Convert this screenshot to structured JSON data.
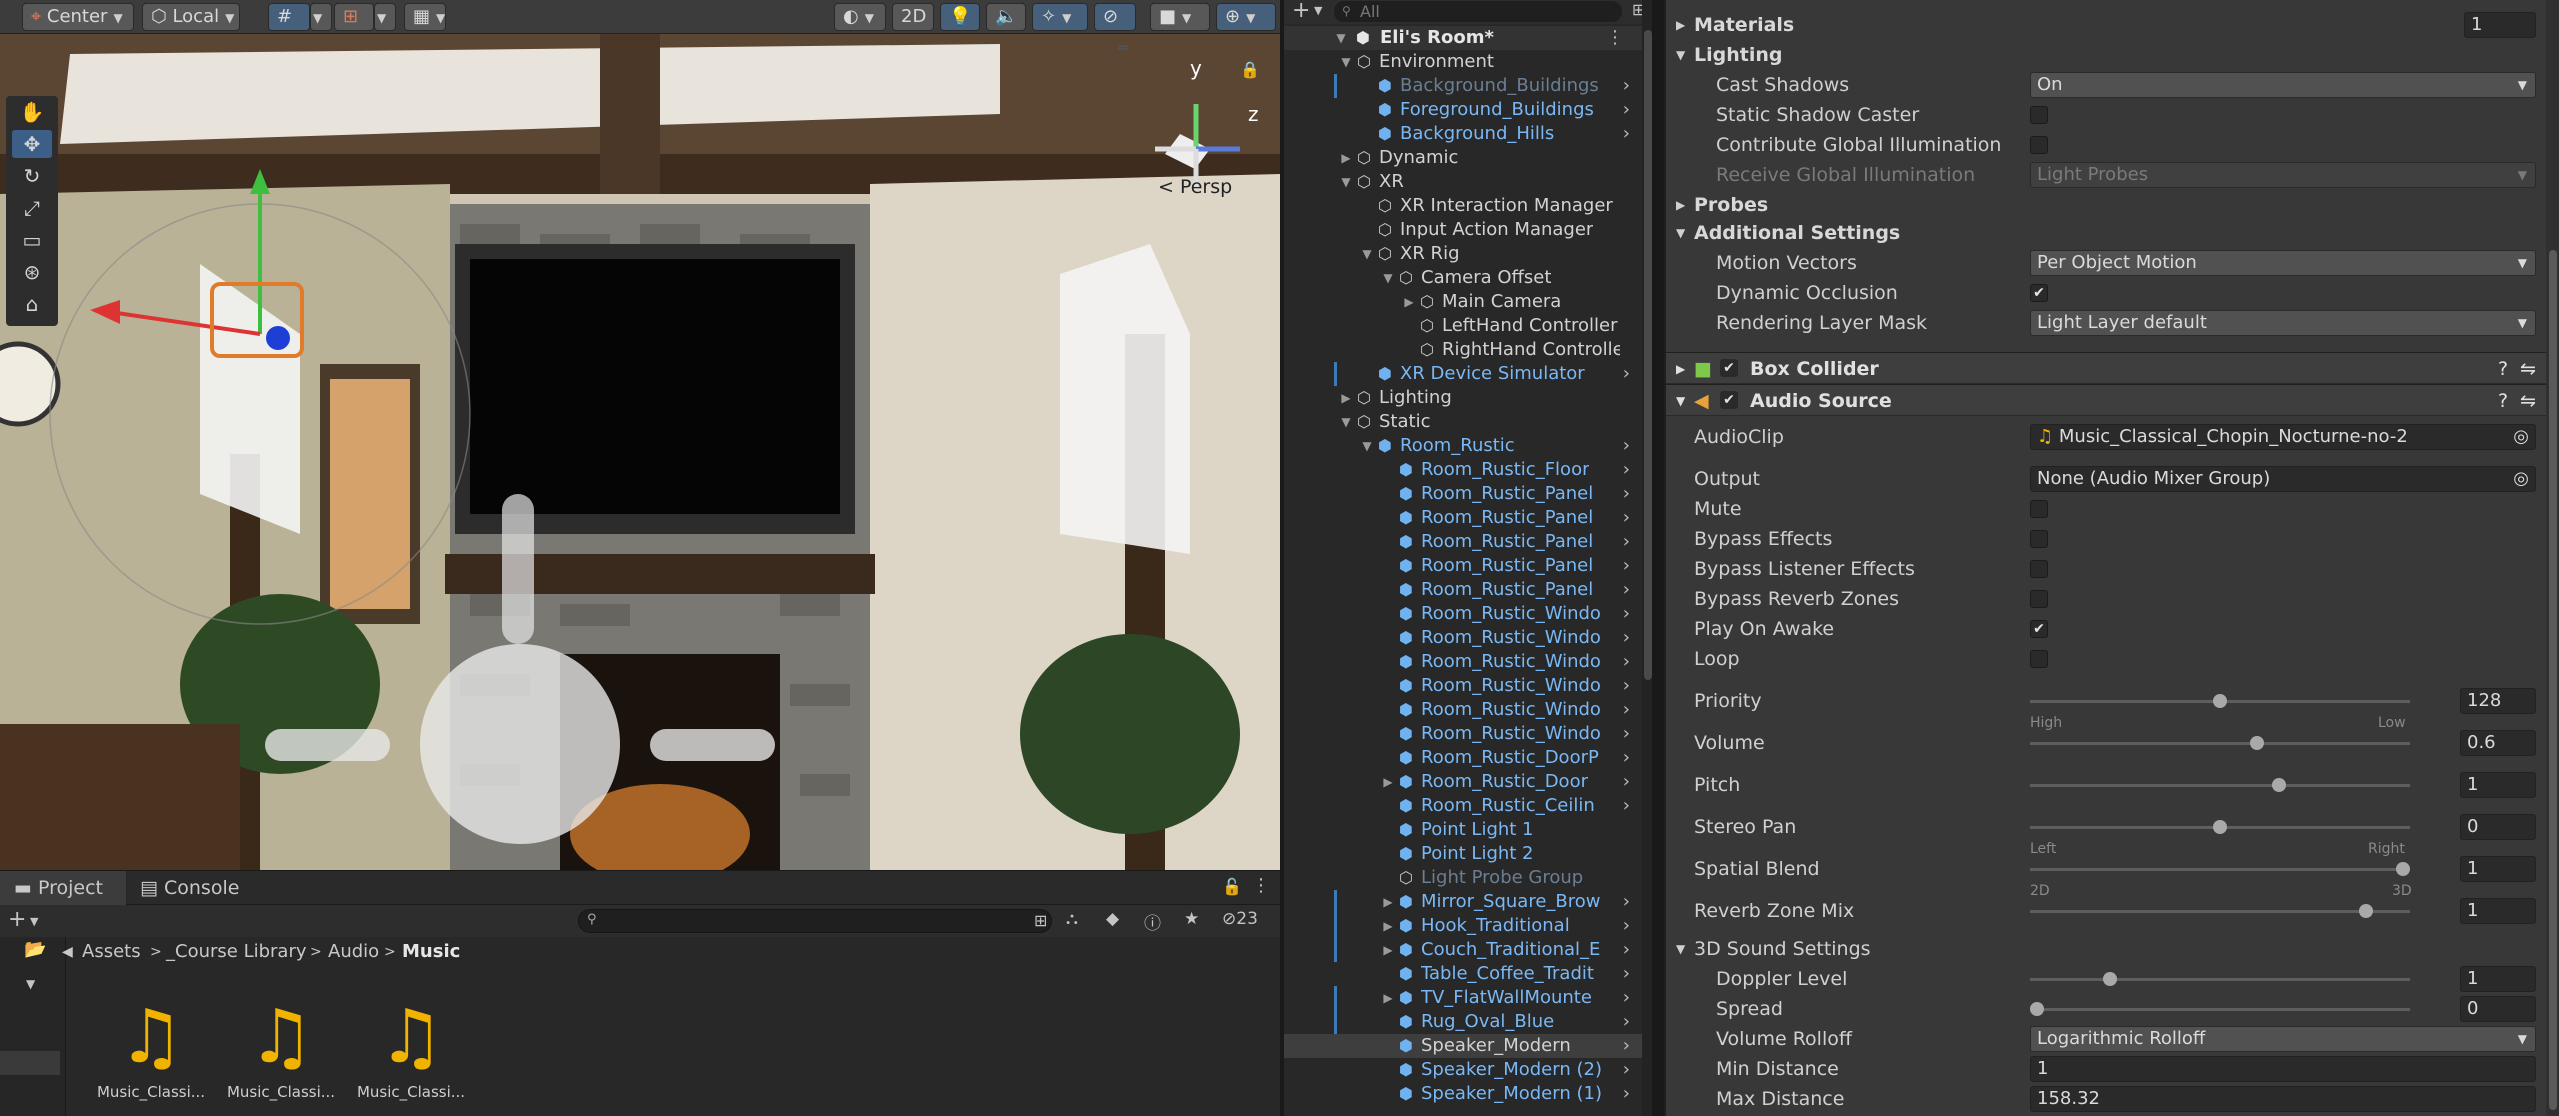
{
  "toolbar": {
    "pivot": "Center",
    "space": "Local",
    "mode_2d": "2D",
    "search_placeholder": "All"
  },
  "scene": {
    "persp_label": "< Persp",
    "gizmo_y": "y",
    "gizmo_z": "z"
  },
  "project": {
    "tab_project": "Project",
    "tab_console": "Console",
    "breadcrumb": [
      "Assets",
      "_Course Library",
      "Audio",
      "Music"
    ],
    "hidden_count": "23",
    "assets": [
      "Music_Classi...",
      "Music_Classi...",
      "Music_Classi..."
    ]
  },
  "hierarchy": {
    "scene_name": "Eli's Room*",
    "items": [
      {
        "label": "Environment",
        "depth": 1,
        "expanded": true,
        "style": "plain",
        "kind": "object"
      },
      {
        "label": "Background_Buildings",
        "depth": 2,
        "style": "dim",
        "kind": "prefab",
        "more": true,
        "bar": true
      },
      {
        "label": "Foreground_Buildings",
        "depth": 2,
        "style": "blue",
        "kind": "prefab",
        "more": true
      },
      {
        "label": "Background_Hills",
        "depth": 2,
        "style": "blue",
        "kind": "prefab",
        "more": true
      },
      {
        "label": "Dynamic",
        "depth": 1,
        "expanded": false,
        "style": "plain",
        "kind": "object"
      },
      {
        "label": "XR",
        "depth": 1,
        "expanded": true,
        "style": "plain",
        "kind": "object"
      },
      {
        "label": "XR Interaction Manager",
        "depth": 2,
        "style": "plain",
        "kind": "object"
      },
      {
        "label": "Input Action Manager",
        "depth": 2,
        "style": "plain",
        "kind": "object"
      },
      {
        "label": "XR Rig",
        "depth": 2,
        "expanded": true,
        "style": "plain",
        "kind": "object"
      },
      {
        "label": "Camera Offset",
        "depth": 3,
        "expanded": true,
        "style": "plain",
        "kind": "object"
      },
      {
        "label": "Main Camera",
        "depth": 4,
        "expanded": false,
        "style": "plain",
        "kind": "object"
      },
      {
        "label": "LeftHand Controller",
        "depth": 4,
        "style": "plain",
        "kind": "object"
      },
      {
        "label": "RightHand Controlle",
        "depth": 4,
        "style": "plain",
        "kind": "object"
      },
      {
        "label": "XR Device Simulator",
        "depth": 2,
        "style": "blue",
        "kind": "prefab",
        "more": true,
        "bar": true
      },
      {
        "label": "Lighting",
        "depth": 1,
        "expanded": false,
        "style": "plain",
        "kind": "object"
      },
      {
        "label": "Static",
        "depth": 1,
        "expanded": true,
        "style": "plain",
        "kind": "object"
      },
      {
        "label": "Room_Rustic",
        "depth": 2,
        "expanded": true,
        "style": "blue",
        "kind": "prefab",
        "more": true
      },
      {
        "label": "Room_Rustic_Floor",
        "depth": 3,
        "style": "blue",
        "kind": "prefab",
        "more": true
      },
      {
        "label": "Room_Rustic_Panel",
        "depth": 3,
        "style": "blue",
        "kind": "prefab",
        "more": true
      },
      {
        "label": "Room_Rustic_Panel",
        "depth": 3,
        "style": "blue",
        "kind": "prefab",
        "more": true
      },
      {
        "label": "Room_Rustic_Panel",
        "depth": 3,
        "style": "blue",
        "kind": "prefab",
        "more": true
      },
      {
        "label": "Room_Rustic_Panel",
        "depth": 3,
        "style": "blue",
        "kind": "prefab",
        "more": true
      },
      {
        "label": "Room_Rustic_Panel",
        "depth": 3,
        "style": "blue",
        "kind": "prefab",
        "more": true
      },
      {
        "label": "Room_Rustic_Windo",
        "depth": 3,
        "style": "blue",
        "kind": "prefab",
        "more": true
      },
      {
        "label": "Room_Rustic_Windo",
        "depth": 3,
        "style": "blue",
        "kind": "prefab",
        "more": true
      },
      {
        "label": "Room_Rustic_Windo",
        "depth": 3,
        "style": "blue",
        "kind": "prefab",
        "more": true
      },
      {
        "label": "Room_Rustic_Windo",
        "depth": 3,
        "style": "blue",
        "kind": "prefab",
        "more": true
      },
      {
        "label": "Room_Rustic_Windo",
        "depth": 3,
        "style": "blue",
        "kind": "prefab",
        "more": true
      },
      {
        "label": "Room_Rustic_Windo",
        "depth": 3,
        "style": "blue",
        "kind": "prefab",
        "more": true
      },
      {
        "label": "Room_Rustic_DoorP",
        "depth": 3,
        "style": "blue",
        "kind": "prefab",
        "more": true
      },
      {
        "label": "Room_Rustic_Door",
        "depth": 3,
        "expanded": false,
        "style": "blue",
        "kind": "prefab",
        "more": true
      },
      {
        "label": "Room_Rustic_Ceilin",
        "depth": 3,
        "style": "blue",
        "kind": "prefab",
        "more": true
      },
      {
        "label": "Point Light 1",
        "depth": 3,
        "style": "blue",
        "kind": "prefab"
      },
      {
        "label": "Point Light 2",
        "depth": 3,
        "style": "blue",
        "kind": "prefab"
      },
      {
        "label": "Light Probe Group",
        "depth": 3,
        "style": "dim",
        "kind": "object"
      },
      {
        "label": "Mirror_Square_Brow",
        "depth": 3,
        "expanded": false,
        "style": "blue",
        "kind": "prefab-green",
        "more": true,
        "bar": true
      },
      {
        "label": "Hook_Traditional",
        "depth": 3,
        "expanded": false,
        "style": "blue",
        "kind": "prefab-green",
        "more": true,
        "bar": true
      },
      {
        "label": "Couch_Traditional_E",
        "depth": 3,
        "expanded": false,
        "style": "blue",
        "kind": "prefab-green",
        "more": true,
        "bar": true
      },
      {
        "label": "Table_Coffee_Tradit",
        "depth": 3,
        "style": "blue",
        "kind": "prefab-green",
        "more": true
      },
      {
        "label": "TV_FlatWallMounte",
        "depth": 3,
        "expanded": false,
        "style": "blue",
        "kind": "prefab-green",
        "more": true,
        "bar": true
      },
      {
        "label": "Rug_Oval_Blue",
        "depth": 3,
        "style": "blue",
        "kind": "prefab-green",
        "more": true,
        "bar": true
      },
      {
        "label": "Speaker_Modern",
        "depth": 3,
        "style": "plain",
        "kind": "prefab-green",
        "more": true,
        "selected": true
      },
      {
        "label": "Speaker_Modern (2)",
        "depth": 3,
        "style": "blue",
        "kind": "prefab-green",
        "more": true
      },
      {
        "label": "Speaker_Modern (1)",
        "depth": 3,
        "style": "blue",
        "kind": "prefab-green",
        "more": true
      }
    ]
  },
  "inspector": {
    "materials": {
      "label": "Materials",
      "count": "1"
    },
    "lighting": {
      "header": "Lighting",
      "cast_shadows": {
        "label": "Cast Shadows",
        "value": "On"
      },
      "static_shadow": {
        "label": "Static Shadow Caster"
      },
      "contribute_gi": {
        "label": "Contribute Global Illumination"
      },
      "receive_gi": {
        "label": "Receive Global Illumination",
        "value": "Light Probes"
      }
    },
    "probes": {
      "header": "Probes"
    },
    "additional": {
      "header": "Additional Settings",
      "motion_vectors": {
        "label": "Motion Vectors",
        "value": "Per Object Motion"
      },
      "dynamic_occlusion": {
        "label": "Dynamic Occlusion"
      },
      "rendering_layer": {
        "label": "Rendering Layer Mask",
        "value": "Light Layer default"
      }
    },
    "box_collider": {
      "title": "Box Collider"
    },
    "audio_source": {
      "title": "Audio Source",
      "audioclip": {
        "label": "AudioClip",
        "value": "Music_Classical_Chopin_Nocturne-no-2"
      },
      "output": {
        "label": "Output",
        "value": "None (Audio Mixer Group)"
      },
      "mute": {
        "label": "Mute",
        "checked": false
      },
      "bypass_effects": {
        "label": "Bypass Effects",
        "checked": false
      },
      "bypass_listener": {
        "label": "Bypass Listener Effects",
        "checked": false
      },
      "bypass_reverb": {
        "label": "Bypass Reverb Zones",
        "checked": false
      },
      "play_on_awake": {
        "label": "Play On Awake",
        "checked": true
      },
      "loop": {
        "label": "Loop",
        "checked": false
      },
      "priority": {
        "label": "Priority",
        "value": "128",
        "fraction": 0.5,
        "low_label": "High",
        "high_label": "Low"
      },
      "volume": {
        "label": "Volume",
        "value": "0.6",
        "fraction": 0.6
      },
      "pitch": {
        "label": "Pitch",
        "value": "1",
        "fraction": 0.66
      },
      "stereo_pan": {
        "label": "Stereo Pan",
        "value": "0",
        "fraction": 0.5,
        "low_label": "Left",
        "high_label": "Right"
      },
      "spatial_blend": {
        "label": "Spatial Blend",
        "value": "1",
        "fraction": 1.0,
        "low_label": "2D",
        "high_label": "3D"
      },
      "reverb_mix": {
        "label": "Reverb Zone Mix",
        "value": "1",
        "fraction": 0.9
      },
      "sound3d": {
        "header": "3D Sound Settings",
        "doppler": {
          "label": "Doppler Level",
          "value": "1",
          "fraction": 0.2
        },
        "spread": {
          "label": "Spread",
          "value": "0",
          "fraction": 0.0
        },
        "rolloff": {
          "label": "Volume Rolloff",
          "value": "Logarithmic Rolloff"
        },
        "min_distance": {
          "label": "Min Distance",
          "value": "1"
        },
        "max_distance": {
          "label": "Max Distance",
          "value": "158.32"
        }
      }
    }
  }
}
